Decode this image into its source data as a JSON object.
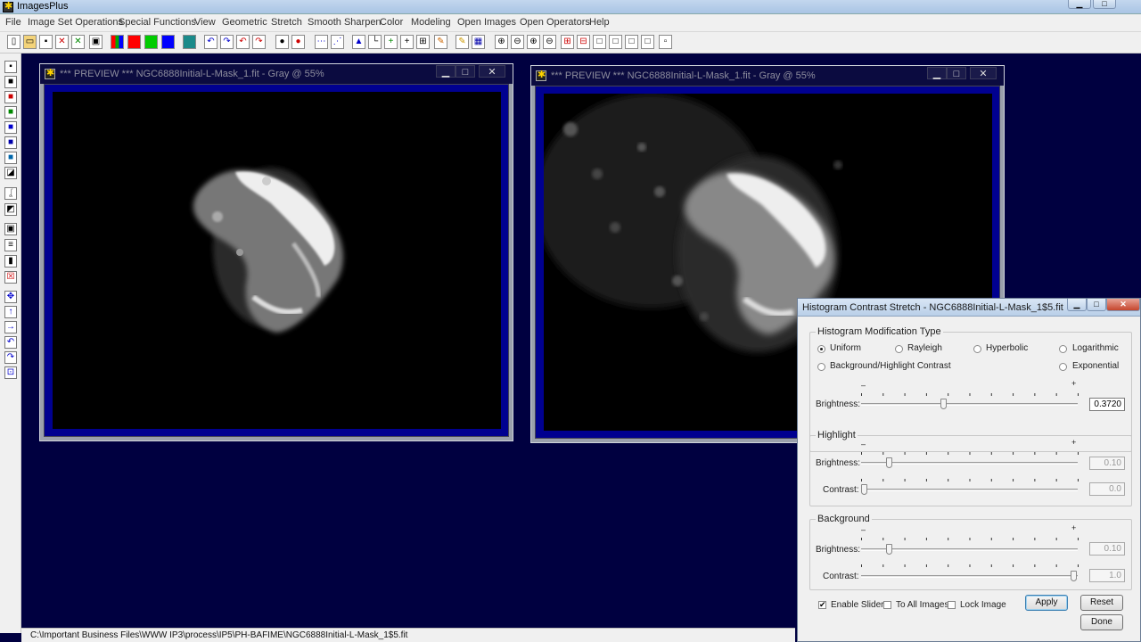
{
  "app": {
    "title": "ImagesPlus"
  },
  "menu": [
    "File",
    "Image Set Operations",
    "Special Functions",
    "View",
    "Geometric",
    "Stretch",
    "Smooth Sharpen",
    "Color",
    "Modeling",
    "Open Images",
    "Open Operators",
    "Help"
  ],
  "windows": [
    {
      "title": "*** PREVIEW *** NGC6888Initial-L-Mask_1.fit - Gray @ 55%"
    },
    {
      "title": "*** PREVIEW *** NGC6888Initial-L-Mask_1.fit - Gray @ 55%"
    }
  ],
  "window_buttons": {
    "minimize": "▁",
    "maximize": "□",
    "close": "✕"
  },
  "dialog": {
    "title": "Histogram Contrast Stretch - NGC6888Initial-L-Mask_1$5.fit",
    "hmt": {
      "label": "Histogram Modification Type",
      "options": [
        "Uniform",
        "Rayleigh",
        "Hyperbolic",
        "Logarithmic",
        "Background/Highlight Contrast",
        "Exponential"
      ],
      "selected": "Uniform"
    },
    "minus": "–",
    "plus": "+",
    "brightness_label": "Brightness:",
    "contrast_label": "Contrast:",
    "main_brightness": {
      "value": "0.3720",
      "level": 0.38
    },
    "highlight": {
      "label": "Highlight",
      "brightness": "0.10",
      "brightness_level": 0.12,
      "contrast": "0.0",
      "contrast_level": 0.0
    },
    "background": {
      "label": "Background",
      "brightness": "0.10",
      "brightness_level": 0.12,
      "contrast": "1.0",
      "contrast_level": 1.0
    },
    "enable_slider": {
      "label": "Enable Slider",
      "checked": true
    },
    "to_all_images": {
      "label": "To All Images",
      "checked": false
    },
    "lock_image": {
      "label": "Lock Image",
      "checked": false
    },
    "apply": "Apply",
    "reset": "Reset",
    "done": "Done"
  },
  "status": {
    "path": "C:\\Important Business Files\\WWW IP3\\process\\IP5\\PH-BAFIME\\NGC6888Initial-L-Mask_1$5.fit"
  }
}
